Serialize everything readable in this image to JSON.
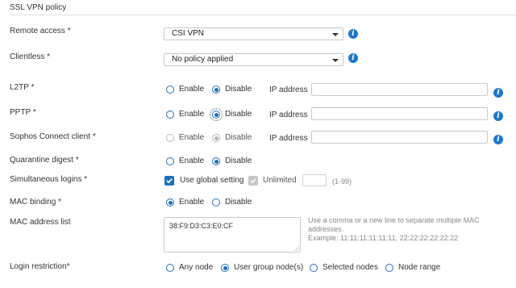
{
  "section": {
    "title": "SSL VPN policy"
  },
  "remote_access": {
    "label": "Remote access *",
    "value": "CSI VPN"
  },
  "clientless": {
    "label": "Clientless *",
    "value": "No policy applied"
  },
  "l2tp": {
    "label": "L2TP *",
    "enable": "Enable",
    "disable": "Disable",
    "ip_label": "IP address",
    "ip_value": ""
  },
  "pptp": {
    "label": "PPTP *",
    "enable": "Enable",
    "disable": "Disable",
    "ip_label": "IP address",
    "ip_value": ""
  },
  "sophos_connect": {
    "label": "Sophos Connect client *",
    "enable": "Enable",
    "disable": "Disable",
    "ip_label": "IP address",
    "ip_value": ""
  },
  "quarantine_digest": {
    "label": "Quarantine digest *",
    "enable": "Enable",
    "disable": "Disable"
  },
  "simultaneous_logins": {
    "label": "Simultaneous logins *",
    "use_global": "Use global setting",
    "unlimited": "Unlimited",
    "value": "",
    "range_hint": "(1-99)"
  },
  "mac_binding": {
    "label": "MAC binding *",
    "enable": "Enable",
    "disable": "Disable"
  },
  "mac_address_list": {
    "label": "MAC address list",
    "value": "38:F9:D3:C3:E0:CF",
    "help_line1": "Use a comma or a new line to separate multiple MAC addresses.",
    "help_line2": "Example: 11:11:11:11:11:11, 22:22:22:22:22:22"
  },
  "login_restriction": {
    "label": "Login restriction*",
    "options": [
      "Any node",
      "User group node(s)",
      "Selected nodes",
      "Node range"
    ],
    "selected": "User group node(s)"
  },
  "colors": {
    "accent": "#1f6fbf",
    "info": "#1f77c9",
    "border": "#c9c9c9",
    "disabled": "#b7b7b7"
  },
  "icons": {
    "info": "info-icon",
    "dropdown": "chevron-down-icon"
  }
}
